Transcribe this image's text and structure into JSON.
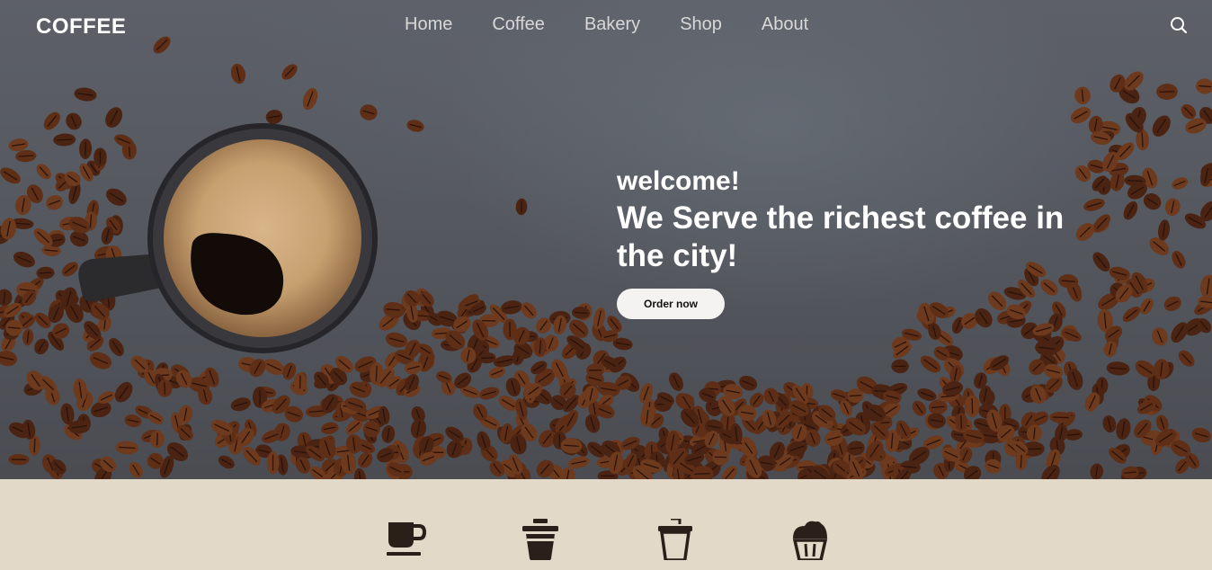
{
  "brand": {
    "name": "COFFEE"
  },
  "nav": {
    "items": [
      "Home",
      "Coffee",
      "Bakery",
      "Shop",
      "About"
    ]
  },
  "search": {
    "icon": "search-icon"
  },
  "hero": {
    "welcome": "welcome!",
    "headline": "We Serve the richest coffee in the city!",
    "cta_label": "Order now"
  },
  "features": {
    "icons": [
      "coffee-cup-icon",
      "takeaway-cup-icon",
      "iced-drink-icon",
      "cupcake-icon"
    ]
  },
  "colors": {
    "feature_band": "#e2d9c8",
    "icon": "#2a2019",
    "cta_background": "#f4f3f1",
    "hero_stone": "#55585f",
    "bean": "#5a2c17"
  }
}
